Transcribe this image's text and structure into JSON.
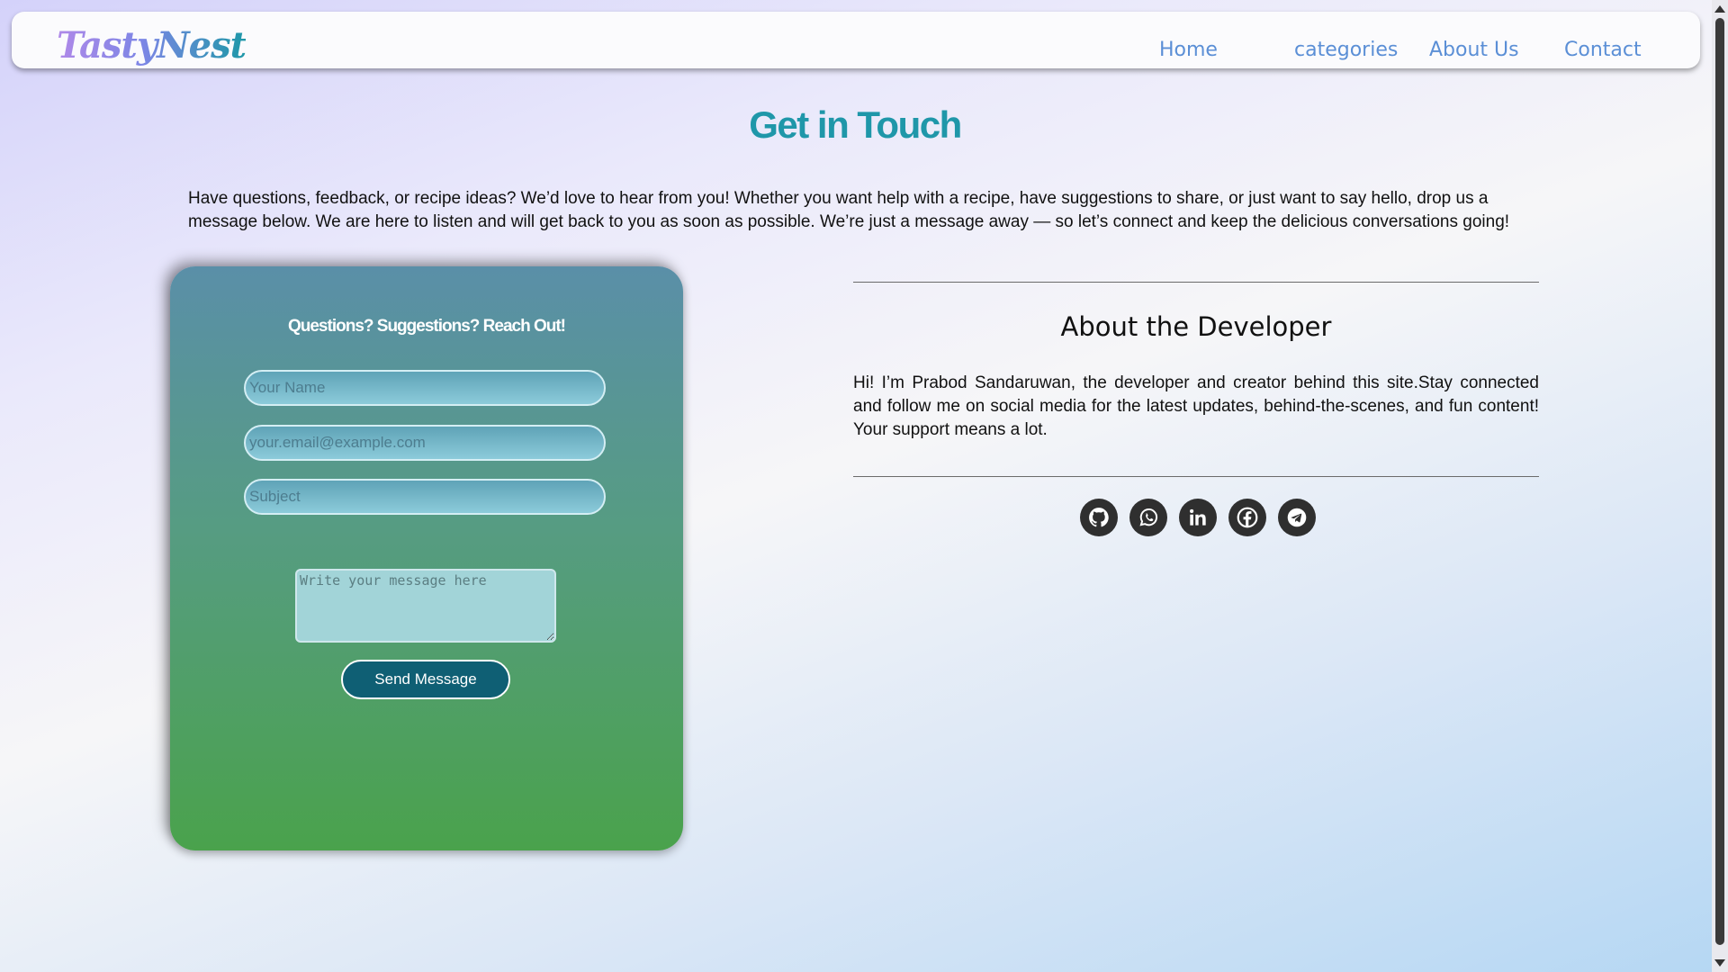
{
  "navbar": {
    "logo": "TastyNest",
    "links": [
      "Home",
      "categories",
      "About Us",
      "Contact"
    ]
  },
  "page": {
    "title": "Get in Touch",
    "intro": "Have questions, feedback, or recipe ideas? We’d love to hear from you! Whether you want help with a recipe, have suggestions to share, or just want to say hello, drop us a message below. We are here to listen and will get back to you as soon as possible. We’re just a message away — so let’s connect and keep the delicious conversations going!"
  },
  "form": {
    "title": "Questions? Suggestions? Reach Out!",
    "name_placeholder": "Your Name",
    "email_placeholder": "your.email@example.com",
    "subject_placeholder": "Subject",
    "message_placeholder": "Write your message here",
    "send_label": "Send Message"
  },
  "developer": {
    "title": "About the Developer",
    "text": "Hi! I’m Prabod Sandaruwan, the developer and creator behind this site.Stay connected and follow me on social media for the latest updates, behind-the-scenes, and fun content! Your support means a lot.",
    "socials": [
      "github-icon",
      "whatsapp-icon",
      "linkedin-icon",
      "facebook-icon",
      "telegram-icon"
    ]
  },
  "colors": {
    "accent": "#1f97a9",
    "nav_link": "#5b8fd6",
    "send_button": "#0f5f74",
    "social_bg": "#2f2f2f"
  }
}
